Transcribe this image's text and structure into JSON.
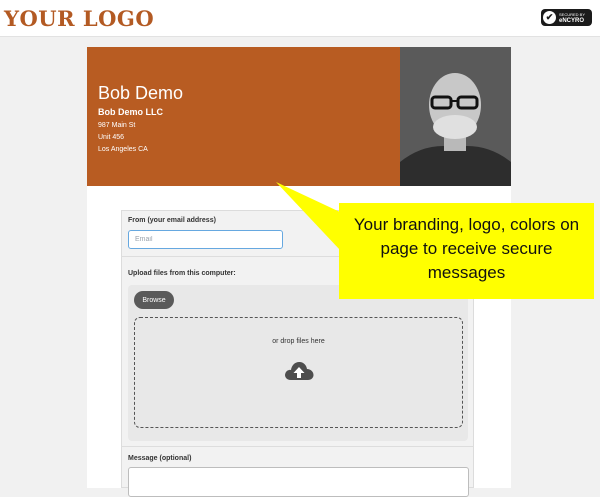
{
  "topbar": {
    "logo_text": "YOUR LOGO",
    "badge_line1": "SECURED BY",
    "badge_line2": "eNCYRO",
    "badge_icon": "check-icon"
  },
  "header": {
    "name": "Bob Demo",
    "company": "Bob Demo LLC",
    "address_lines": [
      "987 Main St",
      "Unit 456",
      "Los Angeles CA"
    ],
    "photo": "profile-photo"
  },
  "form": {
    "from_label": "From (your email address)",
    "email_placeholder": "Email",
    "upload_label": "Upload files from this computer:",
    "browse_label": "Browse",
    "drop_text": "or drop files here",
    "upload_icon": "cloud-upload-icon",
    "message_label": "Message (optional)"
  },
  "callout": {
    "text": "Your branding, logo, colors on page to receive secure messages"
  },
  "colors": {
    "brand": "#b85c22",
    "logo": "#b35a23",
    "callout": "#ffff00",
    "input_focus": "#66a8e0"
  }
}
